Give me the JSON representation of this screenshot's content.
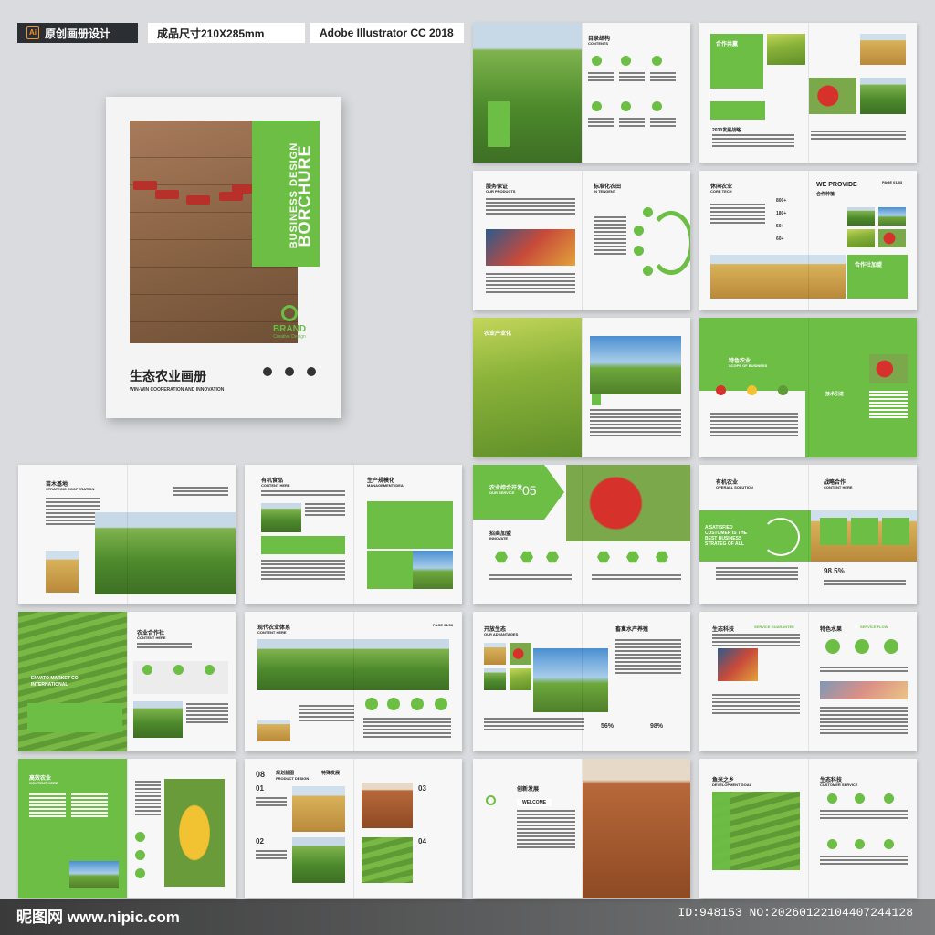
{
  "header": {
    "tag1": "原创画册设计",
    "tag1_icon": "Ai",
    "tag2": "成品尺寸210X285mm",
    "tag3": "Adobe Illustrator CC 2018"
  },
  "cover": {
    "vertical_small": "BUSINESS DESIGN",
    "vertical_big": "BORCHURE",
    "brand": "BRAND",
    "brand_sub": "Creative Design",
    "title": "生态农业画册",
    "subtitle": "WIN-WIN COOPERATION AND INNOVATION"
  },
  "spreads": [
    {
      "id": "s1",
      "heading": "目录结构",
      "sub": "CONTENTS"
    },
    {
      "id": "s2",
      "heading": "合作共赢",
      "sub": "",
      "extra": "2030发展战略"
    },
    {
      "id": "s3",
      "heading": "服务保证",
      "sub": "OUR PRODUCTS",
      "heading2": "标准化农田",
      "sub2": "IN TENGENT"
    },
    {
      "id": "s4",
      "heading": "休闲农业",
      "sub": "CORE TECH",
      "heading2": "WE PROVIDE",
      "sub2": "合作种植",
      "page": "PAGE 01/03",
      "extra": "合作社加盟",
      "stats": [
        "800+",
        "180+",
        "50+",
        "60+"
      ]
    },
    {
      "id": "s5",
      "heading": "农业产业化",
      "sub": ""
    },
    {
      "id": "s6",
      "heading": "特色农业",
      "sub": "SCOPE OF BUSINESS",
      "extra": "技术引进"
    },
    {
      "id": "s7",
      "heading": "苗木基地",
      "sub": "STRATEGIC COOPERATION"
    },
    {
      "id": "s8",
      "heading": "有机食品",
      "sub": "CONTENT HERE",
      "heading2": "生产规模化",
      "sub2": "MANAGEMENT IDEA"
    },
    {
      "id": "s9",
      "heading": "农业综合开发",
      "sub": "OUR SERVICE",
      "heading2": "招商加盟",
      "sub2": "INNOVATE",
      "num": "05"
    },
    {
      "id": "s10",
      "heading": "有机农业",
      "sub": "OVERALL SOLUTION",
      "heading2": "战略合作",
      "sub2": "CONTENT HERE",
      "quote": "A SATISFIED CUSTOMER IS THE BEST BUSINESS STRATEG OF ALL",
      "stat": "98.5%"
    },
    {
      "id": "s11",
      "heading": "农业合作社",
      "sub": "CONTENT HERE",
      "quote": "ENVATO MARKET CO INTERNATIONAL"
    },
    {
      "id": "s12",
      "heading": "现代农业体系",
      "sub": "CONTENT HERE",
      "page": "PAGE 01/03"
    },
    {
      "id": "s13",
      "heading": "开放生态",
      "sub": "OUR ADVANTAGES",
      "heading2": "畜禽水产养殖",
      "stats": [
        "56%",
        "98%"
      ]
    },
    {
      "id": "s14",
      "heading": "生态科技",
      "sub": "SERVICE GUARANTEE",
      "heading2": "特色水果",
      "sub2": "SERVICE FLOW"
    },
    {
      "id": "s15",
      "heading": "高效农业",
      "sub": "CONTENT HERE"
    },
    {
      "id": "s16",
      "heading": "规划蓝图",
      "sub": "PRODUCT DESIGN",
      "heading2": "特殊发展",
      "nums": [
        "08",
        "01",
        "02",
        "03",
        "04"
      ]
    },
    {
      "id": "s17",
      "heading": "创新发展",
      "sub": "WELCOME"
    },
    {
      "id": "s18",
      "heading": "鱼米之乡",
      "sub": "DEVELOPMENT GOAL",
      "heading2": "生态科技",
      "sub2": "CUSTOMER SERVICE"
    }
  ],
  "watermark": {
    "left": "昵图网 www.nipic.com",
    "right": "ID:948153 NO:20260122104407244128"
  },
  "colors": {
    "accent": "#6cbe45",
    "bg": "#d9dbde"
  }
}
